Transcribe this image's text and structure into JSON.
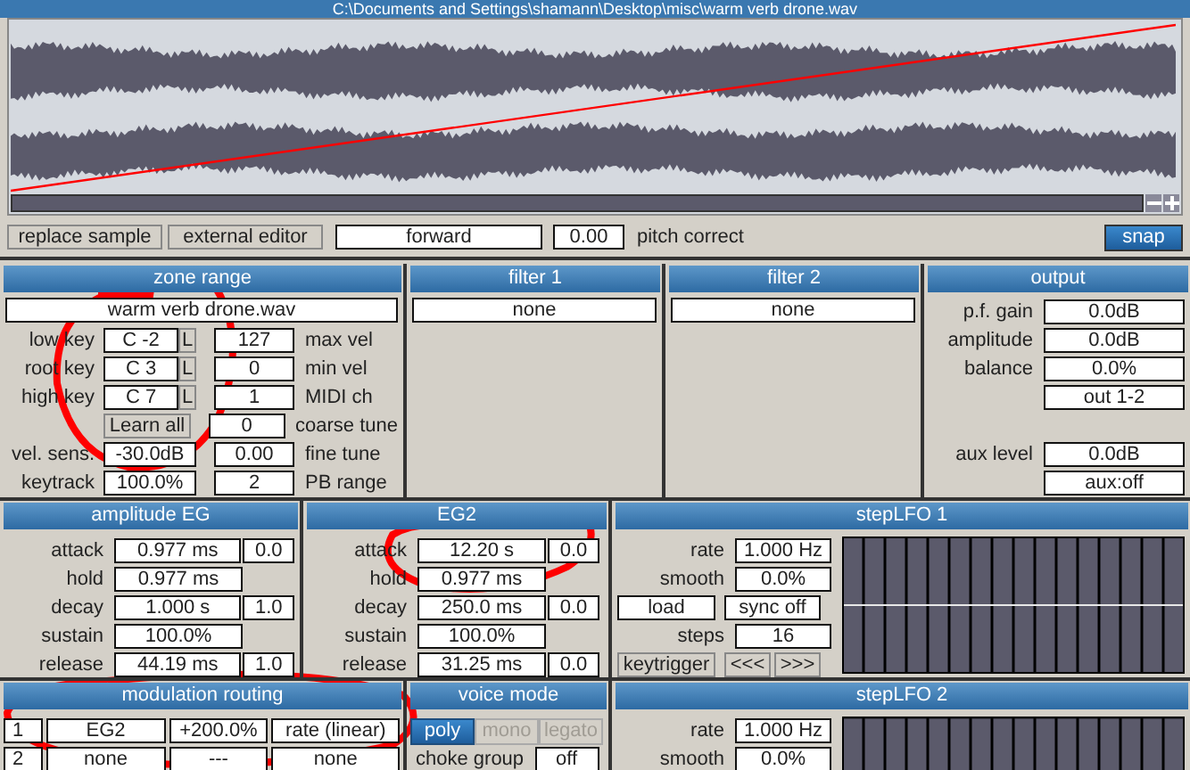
{
  "window": {
    "title": "C:\\Documents and Settings\\shamann\\Desktop\\misc\\warm verb drone.wav"
  },
  "sample_bar": {
    "buttons": [
      "replace sample",
      "external editor"
    ],
    "playback_mode": "forward",
    "pitch_value": "0.00",
    "pitch_label": "pitch correct",
    "snap": {
      "label": "snap",
      "on": true
    }
  },
  "zone_range": {
    "title": "zone range",
    "sample": "warm verb drone.wav",
    "rows": [
      {
        "label": "low key",
        "value": "C -2",
        "lock": "L",
        "value2": "127",
        "label2": "max vel"
      },
      {
        "label": "root key",
        "value": "C 3",
        "lock": "L",
        "value2": "0",
        "label2": "min vel"
      },
      {
        "label": "high key",
        "value": "C 7",
        "lock": "L",
        "value2": "1",
        "label2": "MIDI ch"
      },
      {
        "button": "Learn all",
        "value2": "0",
        "label2": "coarse tune"
      },
      {
        "label": "vel. sens.",
        "value": "-30.0dB",
        "value2": "0.00",
        "label2": "fine tune"
      },
      {
        "label": "keytrack",
        "value": "100.0%",
        "value2": "2",
        "label2": "PB range"
      }
    ]
  },
  "filter_1": {
    "title": "filter 1",
    "type": "none"
  },
  "filter_2": {
    "title": "filter 2",
    "type": "none"
  },
  "output": {
    "title": "output",
    "groups": [
      [
        {
          "label": "p.f. gain",
          "value": "0.0dB"
        },
        {
          "label": "amplitude",
          "value": "0.0dB"
        },
        {
          "label": "balance",
          "value": "0.0%"
        },
        {
          "value": "out 1-2"
        }
      ],
      [
        {
          "label": "aux level",
          "value": "0.0dB"
        },
        {
          "value": "aux:off"
        }
      ]
    ]
  },
  "amplitude_eg": {
    "title": "amplitude EG",
    "rows": [
      {
        "label": "attack",
        "value": "0.977 ms",
        "shape": "0.0"
      },
      {
        "label": "hold",
        "value": "0.977 ms"
      },
      {
        "label": "decay",
        "value": "1.000 s",
        "shape": "1.0"
      },
      {
        "label": "sustain",
        "value": "100.0%"
      },
      {
        "label": "release",
        "value": "44.19 ms",
        "shape": "1.0"
      }
    ]
  },
  "eg2": {
    "title": "EG2",
    "rows": [
      {
        "label": "attack",
        "value": "12.20 s",
        "shape": "0.0"
      },
      {
        "label": "hold",
        "value": "0.977 ms"
      },
      {
        "label": "decay",
        "value": "250.0 ms",
        "shape": "0.0"
      },
      {
        "label": "sustain",
        "value": "100.0%"
      },
      {
        "label": "release",
        "value": "31.25 ms",
        "shape": "0.0"
      }
    ]
  },
  "step_lfo_1": {
    "title": "stepLFO 1",
    "rate": {
      "label": "rate",
      "value": "1.000 Hz"
    },
    "smooth": {
      "label": "smooth",
      "value": "0.0%"
    },
    "load": "load",
    "sync": "sync off",
    "steps": {
      "label": "steps",
      "value": "16"
    },
    "keytrigger": "keytrigger",
    "prev": "<<<",
    "next": ">>>"
  },
  "modulation_routing": {
    "title": "modulation routing",
    "rows": [
      {
        "index": "1",
        "source": "EG2",
        "amount": "+200.0%",
        "destination": "rate (linear)"
      },
      {
        "index": "2",
        "source": "none",
        "amount": "---",
        "destination": "none"
      }
    ]
  },
  "voice_mode": {
    "title": "voice mode",
    "options": [
      {
        "label": "poly",
        "selected": true,
        "disabled": false
      },
      {
        "label": "mono",
        "selected": false,
        "disabled": true
      },
      {
        "label": "legato",
        "selected": false,
        "disabled": true
      }
    ],
    "choke_group": {
      "label": "choke group",
      "value": "off"
    }
  },
  "step_lfo_2": {
    "title": "stepLFO 2",
    "rate": {
      "label": "rate",
      "value": "1.000 Hz"
    },
    "smooth": {
      "label": "smooth",
      "value": "0.0%"
    }
  }
}
